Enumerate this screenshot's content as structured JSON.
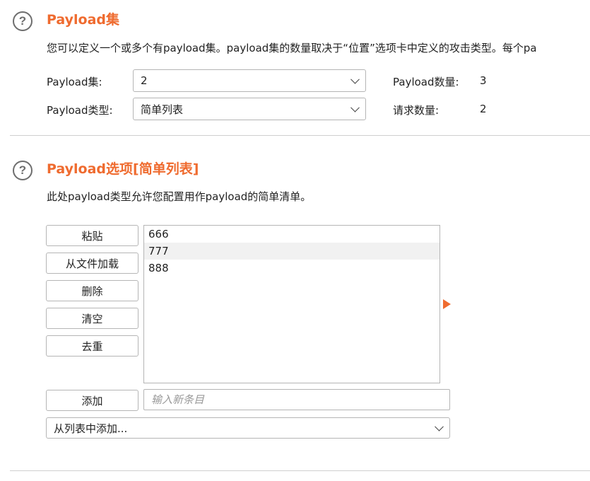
{
  "payload_sets": {
    "title": "Payload集",
    "description": "您可以定义一个或多个有payload集。payload集的数量取决于“位置”选项卡中定义的攻击类型。每个pa",
    "set_label": "Payload集:",
    "set_value": "2",
    "type_label": "Payload类型:",
    "type_value": "简单列表",
    "count_label": "Payload数量:",
    "count_value": "3",
    "request_label": "请求数量:",
    "request_value": "2"
  },
  "payload_options": {
    "title": "Payload选项[简单列表]",
    "description": "此处payload类型允许您配置用作payload的简单清单。",
    "buttons": {
      "paste": "粘贴",
      "load": "从文件加载",
      "remove": "删除",
      "clear": "清空",
      "dedupe": "去重",
      "add": "添加"
    },
    "items": [
      "666",
      "777",
      "888"
    ],
    "selected_index": 1,
    "new_item_placeholder": "输入新条目",
    "add_from_list": "从列表中添加..."
  },
  "colors": {
    "accent": "#ef6b2f",
    "selection": "#f1f1f1"
  }
}
